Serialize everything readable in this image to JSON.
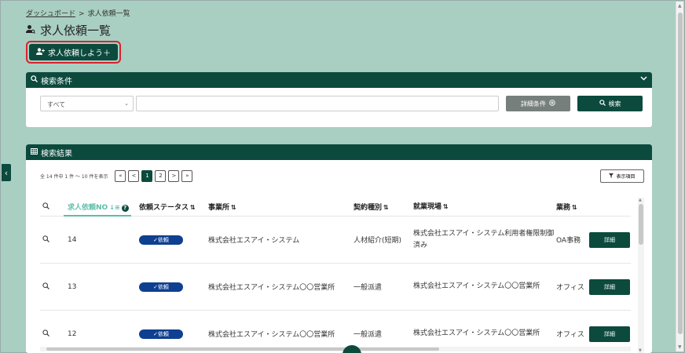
{
  "breadcrumb": {
    "home": "ダッシュボード",
    "separator": ">",
    "current": "求人依頼一覧"
  },
  "page": {
    "title": "求人依頼一覧",
    "add_button": "求人依頼しよう＋"
  },
  "search": {
    "header": "検索条件",
    "select_value": "すべて",
    "input_value": "",
    "detail_button": "詳細条件",
    "search_button": "検索"
  },
  "results": {
    "header": "検索結果",
    "info": "全 14 件中 1 件 ～ 10 件を表示",
    "pager": {
      "first": "«",
      "prev": "<",
      "pages": [
        "1",
        "2"
      ],
      "next": ">",
      "last": "»"
    },
    "columns_button": "表示項目",
    "headers": {
      "no": "求人依頼NO",
      "status": "依頼ステータス",
      "office": "事業所",
      "contract": "契約種別",
      "site": "就業現場",
      "job": "業務"
    },
    "rows": [
      {
        "no": "14",
        "status": "✓依頼",
        "office": "株式会社エスアイ・システム",
        "contract": "人材紹介(短期)",
        "site": "株式会社エスアイ・システム利用者権限制御済み",
        "job": "OA事務",
        "action": "詳細"
      },
      {
        "no": "13",
        "status": "✓依頼",
        "office": "株式会社エスアイ・システム〇〇営業所",
        "contract": "一般派遣",
        "site": "株式会社エスアイ・システム〇〇営業所",
        "job": "オフィス",
        "action": "詳細"
      },
      {
        "no": "12",
        "status": "✓依頼",
        "office": "株式会社エスアイ・システム〇〇営業所",
        "contract": "一般派遣",
        "site": "株式会社エスアイ・システム〇〇営業所",
        "job": "オフィス",
        "action": "詳細"
      }
    ]
  },
  "colors": {
    "primary": "#0c4a3e",
    "background": "#a9cfc2",
    "badge": "#0e3f91",
    "highlight": "#d9232e",
    "accent": "#5cbfa8"
  }
}
